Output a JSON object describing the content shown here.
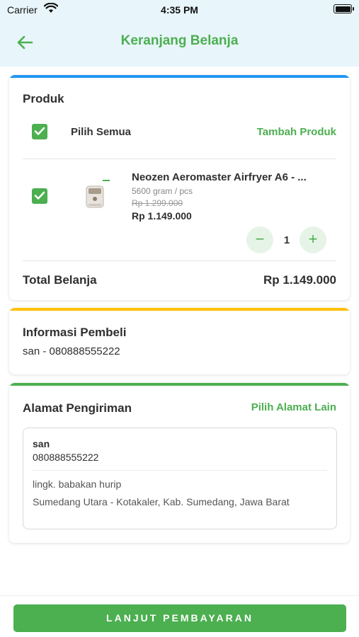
{
  "status_bar": {
    "carrier": "Carrier",
    "time": "4:35 PM"
  },
  "header": {
    "title": "Keranjang Belanja",
    "back_icon": "arrow-left-icon"
  },
  "colors": {
    "accent": "#4caf50",
    "produk_bar": "#2196f3",
    "info_bar": "#ffc107",
    "alamat_bar": "#4caf50",
    "header_bg": "#e8f5fa"
  },
  "produk": {
    "title": "Produk",
    "select_all_label": "Pilih Semua",
    "select_all_checked": true,
    "add_label": "Tambah Produk",
    "items": [
      {
        "checked": true,
        "name": "Neozen Aeromaster Airfryer A6 - ...",
        "weight": "5600 gram / pcs",
        "original_price": "Rp 1.299.000",
        "price": "Rp 1.149.000",
        "quantity": "1"
      }
    ],
    "total_label": "Total Belanja",
    "total_value": "Rp 1.149.000"
  },
  "informasi": {
    "title": "Informasi Pembeli",
    "value": "san - 080888555222"
  },
  "alamat": {
    "title": "Alamat Pengiriman",
    "change_label": "Pilih Alamat Lain",
    "name": "san",
    "phone": "080888555222",
    "street": "lingk. babakan hurip",
    "city": "Sumedang Utara - Kotakaler, Kab. Sumedang, Jawa Barat"
  },
  "footer": {
    "button_label": "LANJUT PEMBAYARAN"
  }
}
